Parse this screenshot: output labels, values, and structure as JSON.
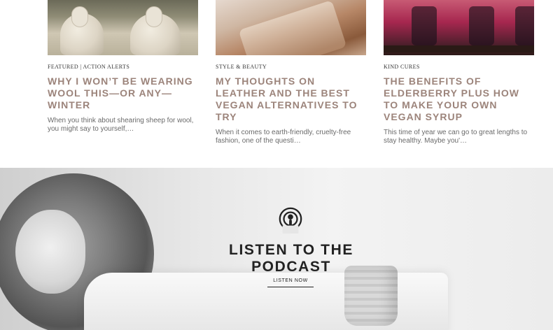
{
  "articles": [
    {
      "category": "FEATURED | ACTION ALERTS",
      "title": "WHY I WON’T BE WEARING WOOL THIS—OR ANY—WINTER",
      "excerpt": "When you think about shearing sheep for wool, you might say to yourself,…"
    },
    {
      "category": "STYLE & BEAUTY",
      "title": "MY THOUGHTS ON LEATHER AND THE BEST VEGAN ALTERNATIVES TO TRY",
      "excerpt": "When it comes to earth-friendly, cruelty-free fashion, one of the questi…"
    },
    {
      "category": "KIND CURES",
      "title": "THE BENEFITS OF ELDERBERRY PLUS HOW TO MAKE YOUR OWN VEGAN SYRUP",
      "excerpt": "This time of year we can go to great lengths to stay healthy. Maybe you'…"
    }
  ],
  "podcast": {
    "icon": "podcast-icon",
    "title": "LISTEN TO THE PODCAST",
    "cta": "LISTEN NOW"
  },
  "colors": {
    "title_accent": "#9c847b",
    "heading": "#222222"
  }
}
